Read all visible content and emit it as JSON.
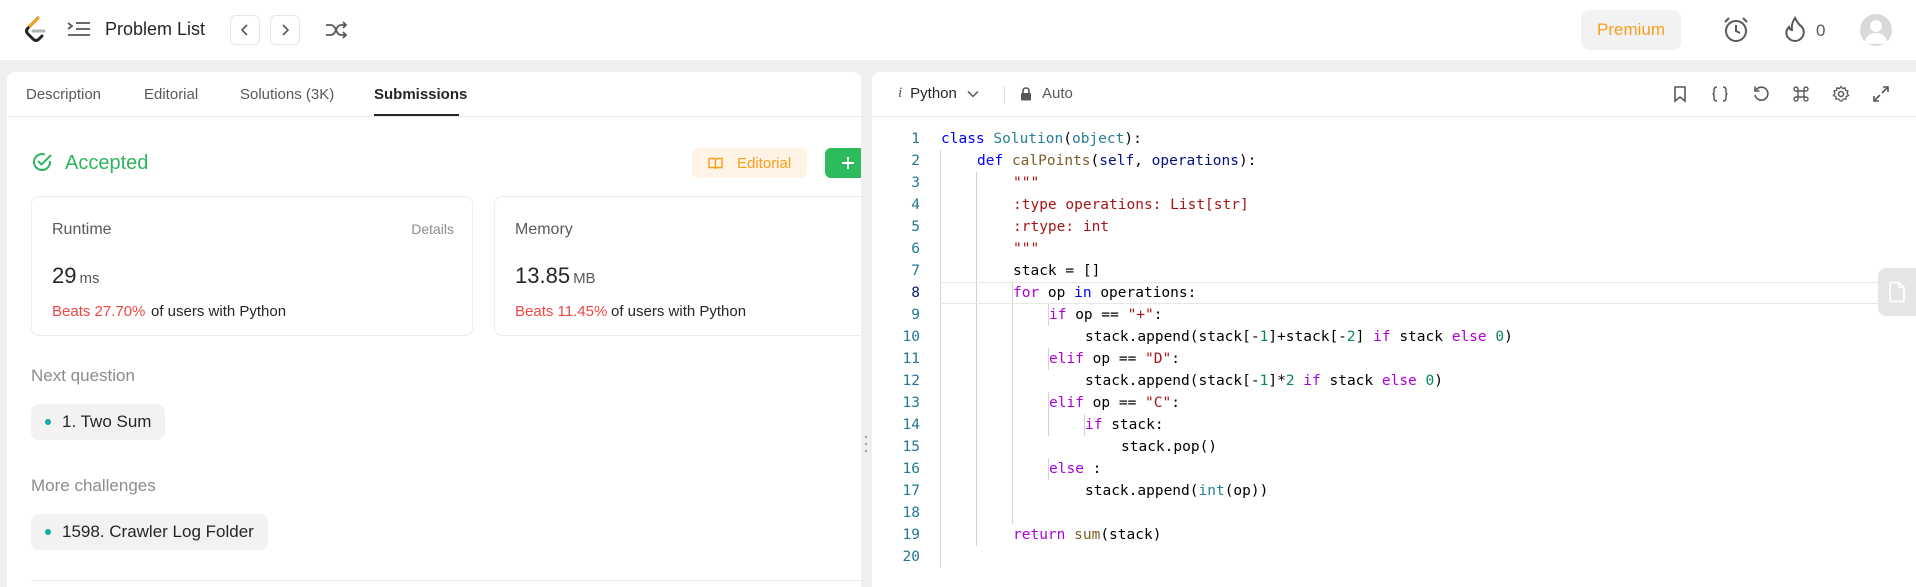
{
  "nav": {
    "title": "Problem List",
    "premium_label": "Premium",
    "streak_count": "0"
  },
  "tabs": [
    {
      "label": "Description"
    },
    {
      "label": "Editorial"
    },
    {
      "label": "Solutions (3K)"
    },
    {
      "label": "Submissions"
    }
  ],
  "submission": {
    "status": "Accepted",
    "editorial_label": "Editorial",
    "runtime": {
      "label": "Runtime",
      "details": "Details",
      "value": "29",
      "unit": "ms",
      "beats": "Beats 27.70%",
      "users": "of users with Python"
    },
    "memory": {
      "label": "Memory",
      "value": "13.85",
      "unit": "MB",
      "beats": "Beats 11.45%",
      "users": "of users with Python"
    },
    "next_question_title": "Next question",
    "next_question": "1. Two Sum",
    "more_challenges_title": "More challenges",
    "more_challenge": "1598. Crawler Log Folder"
  },
  "editor": {
    "language_prefix": "i",
    "language": "Python",
    "mode": "Auto",
    "current_line": 8,
    "lines": [
      {
        "n": "1",
        "text": "class Solution(object):"
      },
      {
        "n": "2",
        "text": "    def calPoints(self, operations):"
      },
      {
        "n": "3",
        "text": "        \"\"\""
      },
      {
        "n": "4",
        "text": "        :type operations: List[str]"
      },
      {
        "n": "5",
        "text": "        :rtype: int"
      },
      {
        "n": "6",
        "text": "        \"\"\""
      },
      {
        "n": "7",
        "text": "        stack = []"
      },
      {
        "n": "8",
        "text": "        for op in operations:"
      },
      {
        "n": "9",
        "text": "            if op == \"+\":"
      },
      {
        "n": "10",
        "text": "                stack.append(stack[-1]+stack[-2] if stack else 0)"
      },
      {
        "n": "11",
        "text": "            elif op == \"D\":"
      },
      {
        "n": "12",
        "text": "                stack.append(stack[-1]*2 if stack else 0)"
      },
      {
        "n": "13",
        "text": "            elif op == \"C\":"
      },
      {
        "n": "14",
        "text": "                if stack:"
      },
      {
        "n": "15",
        "text": "                    stack.pop()"
      },
      {
        "n": "16",
        "text": "            else :"
      },
      {
        "n": "17",
        "text": "                stack.append(int(op))"
      },
      {
        "n": "18",
        "text": ""
      },
      {
        "n": "19",
        "text": "        return sum(stack)"
      },
      {
        "n": "20",
        "text": ""
      }
    ]
  },
  "colors": {
    "accepted": "#2db55d",
    "beats": "#ef4743",
    "premium": "#f89f1b",
    "submit_green": "#2cbb5d"
  }
}
